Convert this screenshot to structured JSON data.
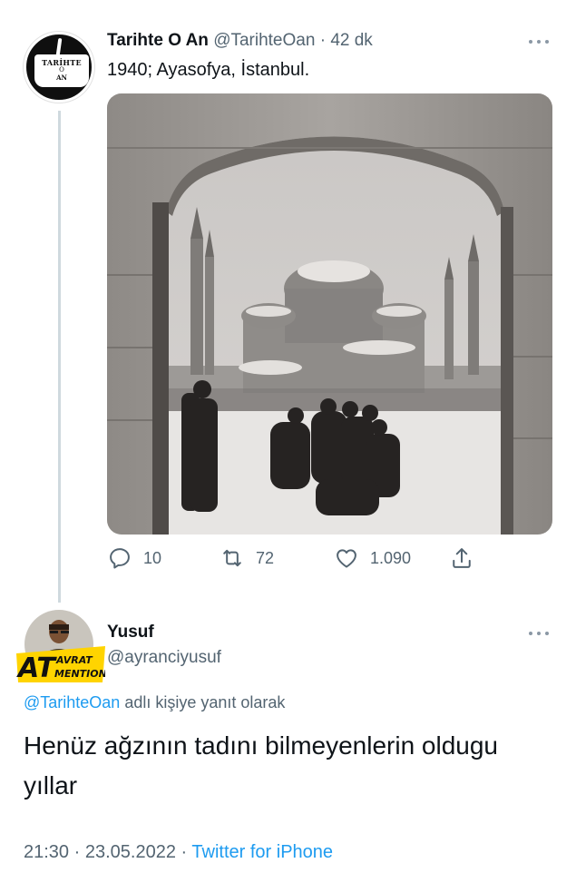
{
  "tweet": {
    "author": {
      "name": "Tarihte O An",
      "handle": "@TarihteOan",
      "avatar_text_top": "TARİHTE",
      "avatar_text_mid": "O",
      "avatar_text_bottom": "AN"
    },
    "separator": "·",
    "time_ago": "42 dk",
    "text": "1940; Ayasofya, İstanbul.",
    "media": {
      "subject": "snowy historic photograph of Hagia Sophia framed by a stone arch with a group of people"
    },
    "stats": {
      "replies": "10",
      "retweets": "72",
      "likes": "1.090"
    },
    "icons": [
      "reply-icon",
      "retweet-icon",
      "like-icon",
      "share-icon",
      "more-icon"
    ]
  },
  "reply": {
    "author": {
      "name": "Yusuf",
      "handle": "@ayranciyusuf",
      "avatar_badge_big": "AT",
      "avatar_badge_top": "AVRAT",
      "avatar_badge_bottom": "MENTION"
    },
    "replying_to_mention": "@TarihteOan",
    "replying_to_suffix": "adlı kişiye yanıt olarak",
    "text": "Henüz ağzının tadını bilmeyenlerin oldugu yıllar",
    "time": "21:30",
    "date": "23.05.2022",
    "source": "Twitter for iPhone"
  },
  "colors": {
    "accent": "#1d9bf0",
    "secondary_text": "#536471",
    "primary_text": "#0f1419",
    "thread_line": "#cfd9de"
  }
}
